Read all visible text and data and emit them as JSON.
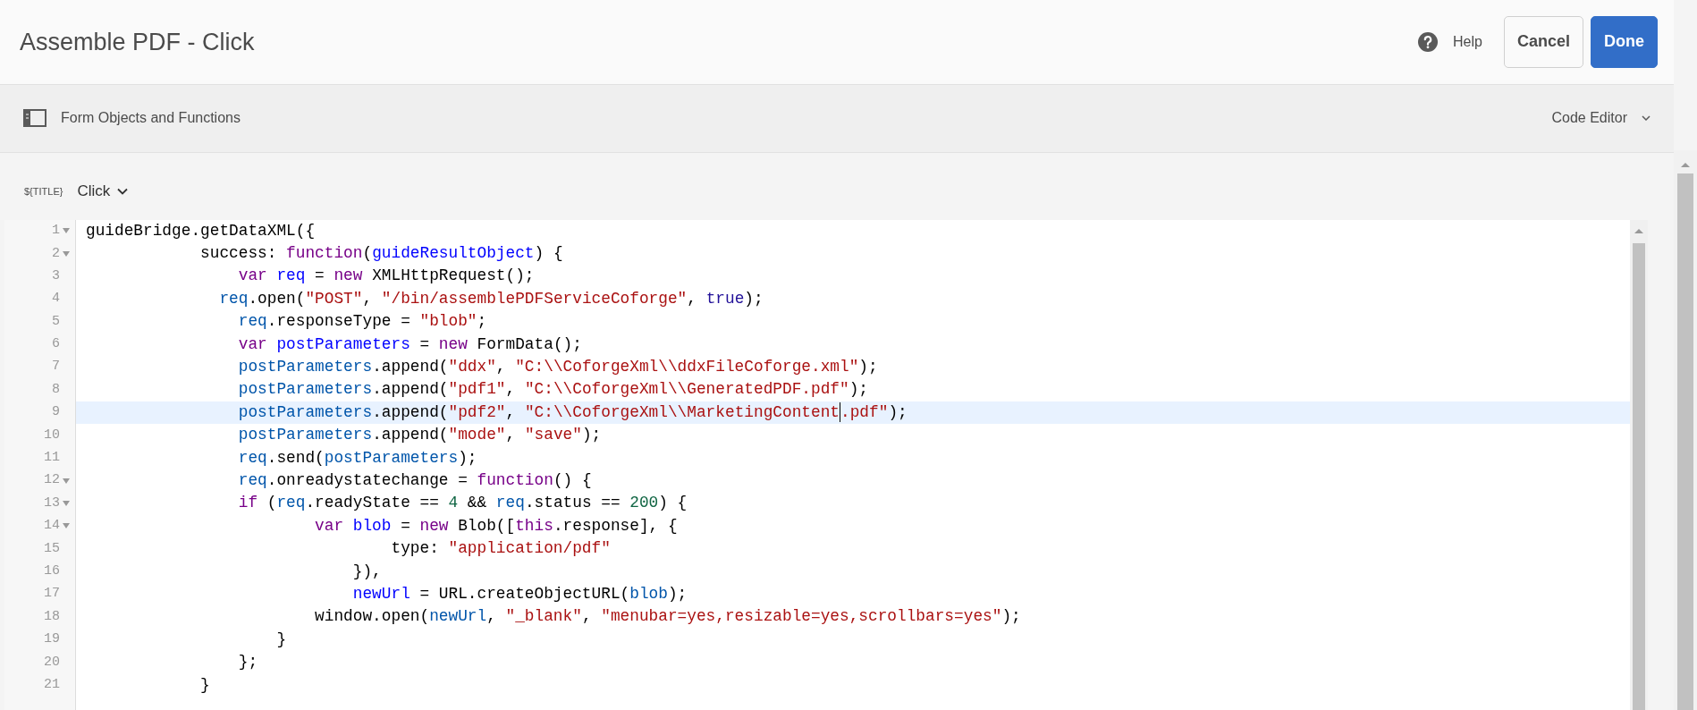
{
  "header": {
    "title": "Assemble PDF - Click",
    "help": "Help",
    "buttons": [
      {
        "label": "Cancel",
        "kind": "secondary"
      },
      {
        "label": "Done",
        "kind": "primary"
      }
    ]
  },
  "toolbar": {
    "label": "Form Objects and Functions",
    "mode": "Code Editor"
  },
  "event": {
    "tag": "${TITLE}",
    "name": "Click"
  },
  "code_lines": [
    {
      "number": "1",
      "fold": true,
      "highlighted": false,
      "tokens": [
        {
          "t": "guideBridge.getDataXML({",
          "kind": "plain"
        }
      ]
    },
    {
      "number": "2",
      "fold": true,
      "highlighted": false,
      "tokens": [
        {
          "t": "            success: ",
          "kind": "plain"
        },
        {
          "t": "function",
          "kind": "keyword"
        },
        {
          "t": "(",
          "kind": "plain"
        },
        {
          "t": "guideResultObject",
          "kind": "def"
        },
        {
          "t": ") {",
          "kind": "plain"
        }
      ]
    },
    {
      "number": "3",
      "fold": false,
      "highlighted": false,
      "tokens": [
        {
          "t": "                var",
          "kind": "keyword"
        },
        {
          "t": " req",
          "kind": "def"
        },
        {
          "t": " = ",
          "kind": "plain"
        },
        {
          "t": "new",
          "kind": "keyword"
        },
        {
          "t": " XMLHttpRequest();",
          "kind": "plain"
        }
      ]
    },
    {
      "number": "4",
      "fold": false,
      "highlighted": false,
      "tokens": [
        {
          "t": "              req",
          "kind": "variable"
        },
        {
          "t": ".open(",
          "kind": "plain"
        },
        {
          "t": "\"POST\"",
          "kind": "string"
        },
        {
          "t": ", ",
          "kind": "plain"
        },
        {
          "t": "\"/bin/assemblePDFServiceCoforge\"",
          "kind": "string"
        },
        {
          "t": ", ",
          "kind": "plain"
        },
        {
          "t": "true",
          "kind": "atom"
        },
        {
          "t": ");",
          "kind": "plain"
        }
      ]
    },
    {
      "number": "5",
      "fold": false,
      "highlighted": false,
      "tokens": [
        {
          "t": "                req",
          "kind": "variable"
        },
        {
          "t": ".responseType = ",
          "kind": "plain"
        },
        {
          "t": "\"blob\"",
          "kind": "string"
        },
        {
          "t": ";",
          "kind": "plain"
        }
      ]
    },
    {
      "number": "6",
      "fold": false,
      "highlighted": false,
      "tokens": [
        {
          "t": "                var",
          "kind": "keyword"
        },
        {
          "t": " postParameters",
          "kind": "def"
        },
        {
          "t": " = ",
          "kind": "plain"
        },
        {
          "t": "new",
          "kind": "keyword"
        },
        {
          "t": " FormData();",
          "kind": "plain"
        }
      ]
    },
    {
      "number": "7",
      "fold": false,
      "highlighted": false,
      "tokens": [
        {
          "t": "                postParameters",
          "kind": "variable"
        },
        {
          "t": ".append(",
          "kind": "plain"
        },
        {
          "t": "\"ddx\"",
          "kind": "string"
        },
        {
          "t": ", ",
          "kind": "plain"
        },
        {
          "t": "\"C:\\\\CoforgeXml\\\\ddxFileCoforge.xml\"",
          "kind": "string"
        },
        {
          "t": ");",
          "kind": "plain"
        }
      ]
    },
    {
      "number": "8",
      "fold": false,
      "highlighted": false,
      "tokens": [
        {
          "t": "                postParameters",
          "kind": "variable"
        },
        {
          "t": ".append(",
          "kind": "plain"
        },
        {
          "t": "\"pdf1\"",
          "kind": "string"
        },
        {
          "t": ", ",
          "kind": "plain"
        },
        {
          "t": "\"C:\\\\CoforgeXml\\\\GeneratedPDF.pdf\"",
          "kind": "string"
        },
        {
          "t": ");",
          "kind": "plain"
        }
      ]
    },
    {
      "number": "9",
      "fold": false,
      "highlighted": true,
      "tokens": [
        {
          "t": "                postParameters",
          "kind": "variable"
        },
        {
          "t": ".append(",
          "kind": "plain"
        },
        {
          "t": "\"pdf2\"",
          "kind": "string"
        },
        {
          "t": ", ",
          "kind": "plain"
        },
        {
          "t": "\"C:\\\\CoforgeXml\\\\MarketingContent",
          "kind": "string",
          "cursor": true
        },
        {
          "t": ".pdf\"",
          "kind": "string"
        },
        {
          "t": ");",
          "kind": "plain"
        }
      ]
    },
    {
      "number": "10",
      "fold": false,
      "highlighted": false,
      "tokens": [
        {
          "t": "                postParameters",
          "kind": "variable"
        },
        {
          "t": ".append(",
          "kind": "plain"
        },
        {
          "t": "\"mode\"",
          "kind": "string"
        },
        {
          "t": ", ",
          "kind": "plain"
        },
        {
          "t": "\"save\"",
          "kind": "string"
        },
        {
          "t": ");",
          "kind": "plain"
        }
      ]
    },
    {
      "number": "11",
      "fold": false,
      "highlighted": false,
      "tokens": [
        {
          "t": "                req",
          "kind": "variable"
        },
        {
          "t": ".send(",
          "kind": "plain"
        },
        {
          "t": "postParameters",
          "kind": "variable"
        },
        {
          "t": ");",
          "kind": "plain"
        }
      ]
    },
    {
      "number": "12",
      "fold": true,
      "highlighted": false,
      "tokens": [
        {
          "t": "                req",
          "kind": "variable"
        },
        {
          "t": ".onreadystatechange = ",
          "kind": "plain"
        },
        {
          "t": "function",
          "kind": "keyword"
        },
        {
          "t": "() {",
          "kind": "plain"
        }
      ]
    },
    {
      "number": "13",
      "fold": true,
      "highlighted": false,
      "tokens": [
        {
          "t": "                if",
          "kind": "keyword"
        },
        {
          "t": " (",
          "kind": "plain"
        },
        {
          "t": "req",
          "kind": "variable"
        },
        {
          "t": ".readyState == ",
          "kind": "plain"
        },
        {
          "t": "4",
          "kind": "number"
        },
        {
          "t": " && ",
          "kind": "plain"
        },
        {
          "t": "req",
          "kind": "variable"
        },
        {
          "t": ".status == ",
          "kind": "plain"
        },
        {
          "t": "200",
          "kind": "number"
        },
        {
          "t": ") {",
          "kind": "plain"
        }
      ]
    },
    {
      "number": "14",
      "fold": true,
      "highlighted": false,
      "tokens": [
        {
          "t": "                        var",
          "kind": "keyword"
        },
        {
          "t": " blob",
          "kind": "def"
        },
        {
          "t": " = ",
          "kind": "plain"
        },
        {
          "t": "new",
          "kind": "keyword"
        },
        {
          "t": " Blob([",
          "kind": "plain"
        },
        {
          "t": "this",
          "kind": "keyword"
        },
        {
          "t": ".response], {",
          "kind": "plain"
        }
      ]
    },
    {
      "number": "15",
      "fold": false,
      "highlighted": false,
      "tokens": [
        {
          "t": "                                type: ",
          "kind": "plain"
        },
        {
          "t": "\"application/pdf\"",
          "kind": "string"
        }
      ]
    },
    {
      "number": "16",
      "fold": false,
      "highlighted": false,
      "tokens": [
        {
          "t": "                            }),",
          "kind": "plain"
        }
      ]
    },
    {
      "number": "17",
      "fold": false,
      "highlighted": false,
      "tokens": [
        {
          "t": "                            newUrl",
          "kind": "def"
        },
        {
          "t": " = URL.createObjectURL(",
          "kind": "plain"
        },
        {
          "t": "blob",
          "kind": "variable"
        },
        {
          "t": ");",
          "kind": "plain"
        }
      ]
    },
    {
      "number": "18",
      "fold": false,
      "highlighted": false,
      "tokens": [
        {
          "t": "                        window.open(",
          "kind": "plain"
        },
        {
          "t": "newUrl",
          "kind": "variable"
        },
        {
          "t": ", ",
          "kind": "plain"
        },
        {
          "t": "\"_blank\"",
          "kind": "string"
        },
        {
          "t": ", ",
          "kind": "plain"
        },
        {
          "t": "\"menubar=yes,resizable=yes,scrollbars=yes\"",
          "kind": "string"
        },
        {
          "t": ");",
          "kind": "plain"
        }
      ]
    },
    {
      "number": "19",
      "fold": false,
      "highlighted": false,
      "tokens": [
        {
          "t": "                    }",
          "kind": "plain"
        }
      ]
    },
    {
      "number": "20",
      "fold": false,
      "highlighted": false,
      "tokens": [
        {
          "t": "                };",
          "kind": "plain"
        }
      ]
    },
    {
      "number": "21",
      "fold": false,
      "highlighted": false,
      "tokens": [
        {
          "t": "            }",
          "kind": "plain"
        }
      ]
    }
  ]
}
